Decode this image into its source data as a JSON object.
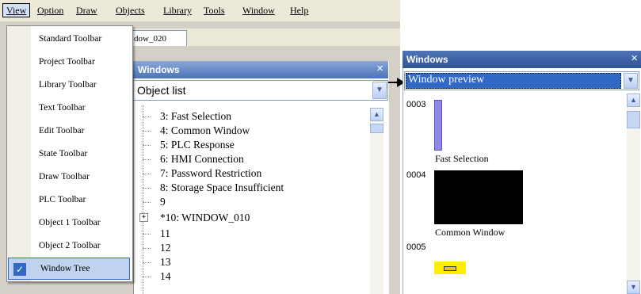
{
  "menubar": {
    "items": [
      "View",
      "Option",
      "Draw",
      "Objects",
      "Library",
      "Tools",
      "Window",
      "Help"
    ]
  },
  "tab": {
    "label": "dow_020"
  },
  "view_menu": {
    "items": [
      {
        "label": "Standard Toolbar",
        "checked": false
      },
      {
        "label": "Project Toolbar",
        "checked": false
      },
      {
        "label": "Library Toolbar",
        "checked": false
      },
      {
        "label": "Text Toolbar",
        "checked": false
      },
      {
        "label": "Edit Toolbar",
        "checked": false
      },
      {
        "label": "State Toolbar",
        "checked": false
      },
      {
        "label": "Draw Toolbar",
        "checked": false
      },
      {
        "label": "PLC Toolbar",
        "checked": false
      },
      {
        "label": "Object 1 Toolbar",
        "checked": false
      },
      {
        "label": "Object 2 Toolbar",
        "checked": false
      },
      {
        "label": "Window Tree",
        "checked": true
      }
    ]
  },
  "windows_panel": {
    "title": "Windows",
    "close": "×",
    "mode": "Object list",
    "tree": [
      "3: Fast Selection",
      "4: Common Window",
      "5: PLC Response",
      "6: HMI Connection",
      "7: Password Restriction",
      "8: Storage Space Insufficient",
      "9",
      "*10: WINDOW_010",
      "11",
      "12",
      "13",
      "14"
    ]
  },
  "preview_panel": {
    "title": "Windows",
    "close": "×",
    "mode": "Window preview",
    "items": [
      {
        "number": "0003",
        "caption": "Fast Selection"
      },
      {
        "number": "0004",
        "caption": "Common Window"
      },
      {
        "number": "0005",
        "caption": ""
      }
    ]
  },
  "colors": {
    "menu_bg": "#ece9d8",
    "highlight": "#316ac5",
    "title_bar": "#4b73b8"
  }
}
